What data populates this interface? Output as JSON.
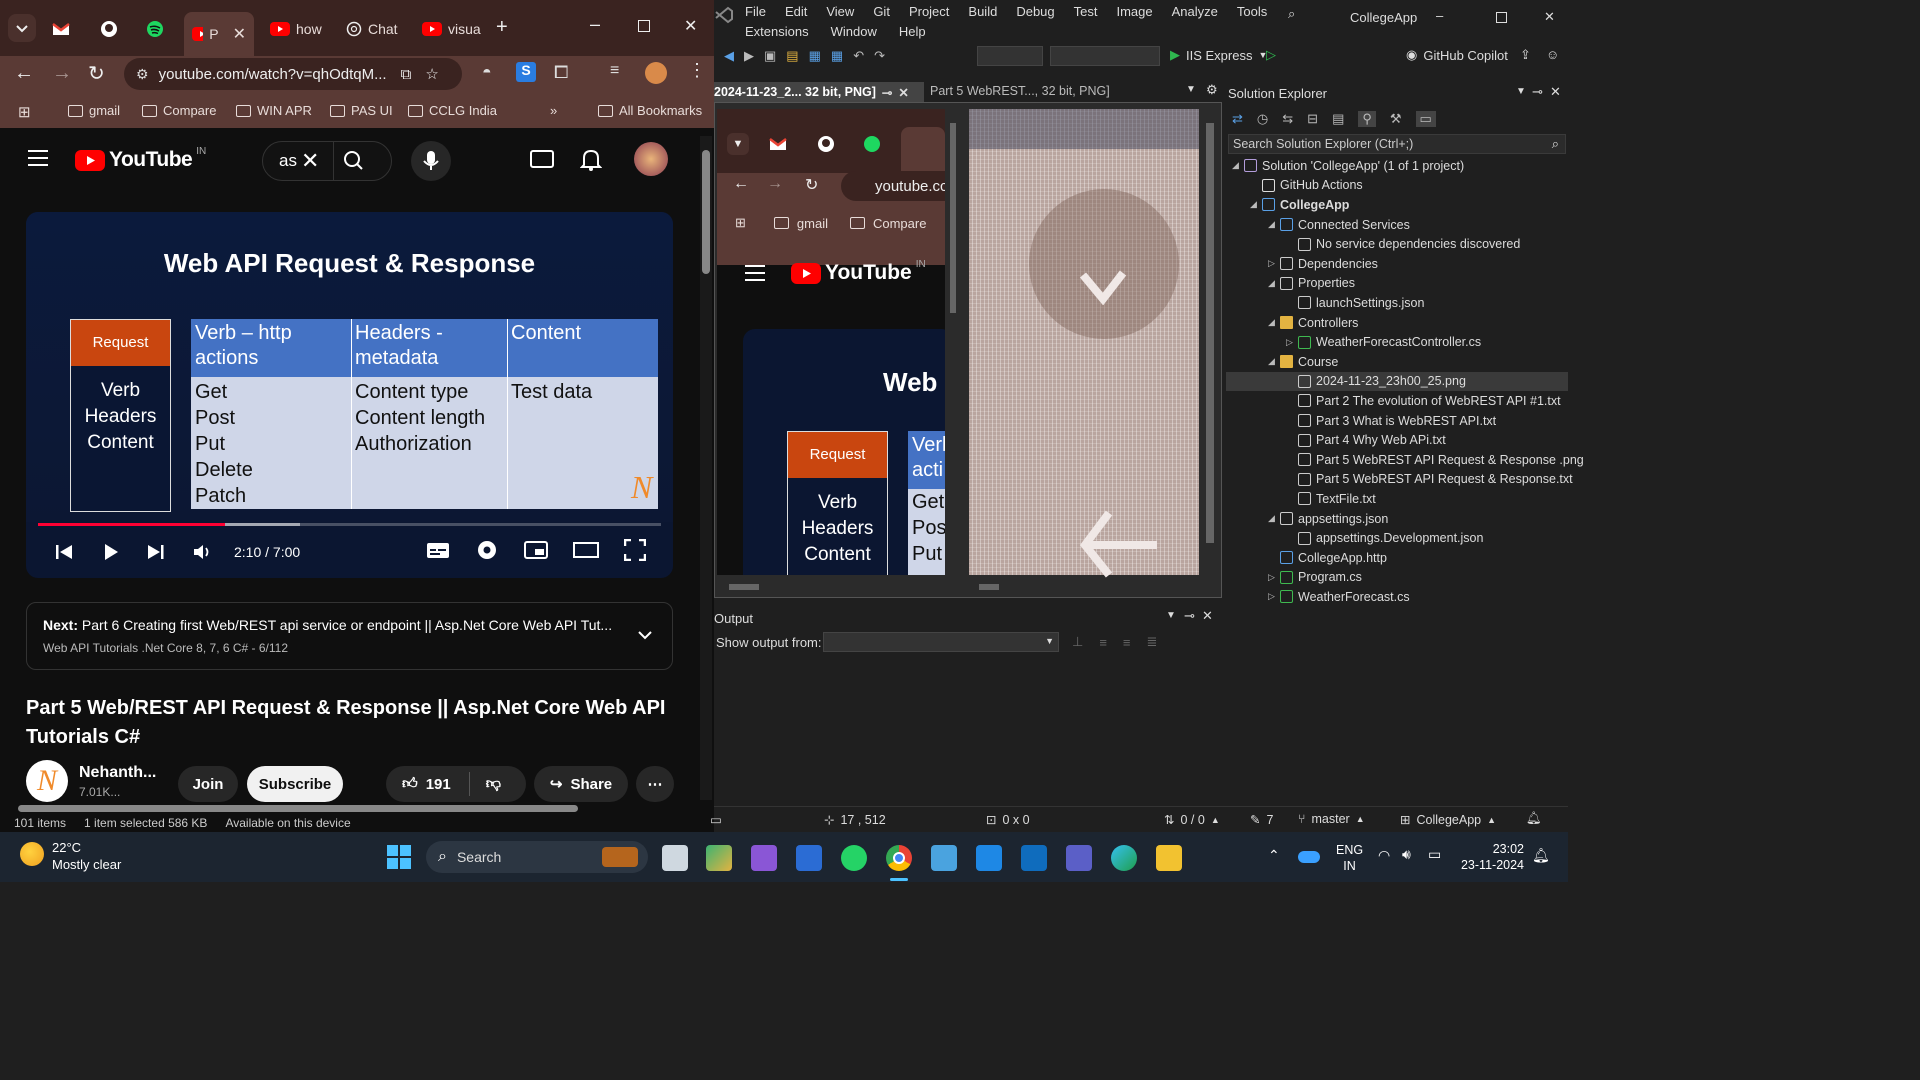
{
  "chrome": {
    "tabs": [
      {
        "label": "",
        "icon": "gmail-icon"
      },
      {
        "label": "",
        "icon": "github-icon"
      },
      {
        "label": "",
        "icon": "spotify-icon"
      },
      {
        "label": "P",
        "icon": "youtube-icon"
      },
      {
        "label": "how",
        "icon": "youtube-icon"
      },
      {
        "label": "Chat",
        "icon": "chatgpt-icon"
      },
      {
        "label": "visua",
        "icon": "youtube-icon"
      }
    ],
    "url": "youtube.com/watch?v=qhOdtqM...",
    "bookmarks": [
      "gmail",
      "Compare",
      "WIN APR",
      "PAS UI",
      "CCLG India"
    ],
    "all_bookmarks": "All Bookmarks",
    "accent": "#5a3a35"
  },
  "youtube": {
    "logo_text": "YouTube",
    "region": "IN",
    "search_text": "as",
    "slide": {
      "title": "Web API Request & Response",
      "request_header": "Request",
      "request_items": [
        "Verb",
        "Headers",
        "Content"
      ],
      "col1_header": "Verb – http actions",
      "col2_header": "Headers - metadata",
      "col3_header": "Content",
      "col1_items": [
        "Get",
        "Post",
        "Put",
        "Delete",
        "Patch"
      ],
      "col2_items": [
        "Content type",
        "Content length",
        "Authorization"
      ],
      "col3_items": [
        "Test data"
      ],
      "watermark": "N"
    },
    "player": {
      "time": "2:10 / 7:00",
      "progress": 0.3,
      "buffered": 0.42
    },
    "next": {
      "prefix": "Next:",
      "title": "Part 6 Creating first Web/REST api service or endpoint || Asp.Net Core Web API Tut...",
      "playlist": "Web API Tutorials .Net Core 8, 7, 6 C# - 6/112"
    },
    "video_title": "Part 5 Web/REST API Request & Response || Asp.Net Core Web API Tutorials C#",
    "channel": "Nehanth...",
    "subscribers": "7.01K...",
    "join": "Join",
    "subscribe": "Subscribe",
    "likes": "191",
    "share": "Share"
  },
  "explorer_status": {
    "items": "101 items",
    "selected": "1 item selected 586 KB",
    "availability": "Available on this device"
  },
  "vs": {
    "menu": [
      "File",
      "Edit",
      "View",
      "Git",
      "Project",
      "Build",
      "Debug",
      "Test",
      "Image",
      "Analyze",
      "Tools"
    ],
    "menu2": [
      "Extensions",
      "Window",
      "Help"
    ],
    "app_name": "CollegeApp",
    "run_label": "IIS Express",
    "copilot": "GitHub Copilot",
    "doc_tabs": [
      "2024-11-23_2... 32 bit, PNG]",
      "Part 5 WebREST..., 32 bit, PNG]"
    ],
    "preview": {
      "bookmarks": [
        "gmail",
        "Compare"
      ],
      "url": "youtube.cc",
      "logo_text": "YouTube",
      "region": "IN",
      "slide_title": "Web",
      "request_header": "Request",
      "request_items": [
        "Verb",
        "Headers",
        "Content"
      ],
      "col_header": "Verl acti",
      "col_items": [
        "Get",
        "Pos",
        "Put"
      ]
    },
    "output": {
      "title": "Output",
      "show_from": "Show output from:"
    },
    "solution_explorer": {
      "title": "Solution Explorer",
      "search_placeholder": "Search Solution Explorer (Ctrl+;)",
      "items": [
        {
          "label": "Solution 'CollegeApp' (1 of 1 project)",
          "level": 0,
          "icon": "solution-icon"
        },
        {
          "label": "GitHub Actions",
          "level": 1,
          "icon": "github-icon"
        },
        {
          "label": "CollegeApp",
          "level": 1,
          "icon": "project-icon",
          "bold": true
        },
        {
          "label": "Connected Services",
          "level": 2,
          "icon": "connected-services-icon"
        },
        {
          "label": "No service dependencies discovered",
          "level": 3,
          "icon": "file-icon"
        },
        {
          "label": "Dependencies",
          "level": 2,
          "icon": "dependencies-icon"
        },
        {
          "label": "Properties",
          "level": 2,
          "icon": "properties-icon"
        },
        {
          "label": "launchSettings.json",
          "level": 3,
          "icon": "json-icon"
        },
        {
          "label": "Controllers",
          "level": 2,
          "icon": "folder-icon"
        },
        {
          "label": "WeatherForecastController.cs",
          "level": 3,
          "icon": "csharp-icon"
        },
        {
          "label": "Course",
          "level": 2,
          "icon": "folder-icon"
        },
        {
          "label": "2024-11-23_23h00_25.png",
          "level": 3,
          "icon": "image-icon",
          "selected": true
        },
        {
          "label": "Part 2 The evolution of WebREST API #1.txt",
          "level": 3,
          "icon": "text-file-icon"
        },
        {
          "label": "Part 3 What is WebREST API.txt",
          "level": 3,
          "icon": "text-file-icon"
        },
        {
          "label": "Part 4 Why Web APi.txt",
          "level": 3,
          "icon": "text-file-icon"
        },
        {
          "label": "Part 5 WebREST API Request & Response .png",
          "level": 3,
          "icon": "image-icon"
        },
        {
          "label": "Part 5 WebREST API Request & Response.txt",
          "level": 3,
          "icon": "text-file-icon"
        },
        {
          "label": "TextFile.txt",
          "level": 3,
          "icon": "text-file-icon"
        },
        {
          "label": "appsettings.json",
          "level": 2,
          "icon": "json-icon"
        },
        {
          "label": "appsettings.Development.json",
          "level": 3,
          "icon": "json-icon"
        },
        {
          "label": "CollegeApp.http",
          "level": 2,
          "icon": "http-icon"
        },
        {
          "label": "Program.cs",
          "level": 2,
          "icon": "csharp-icon"
        },
        {
          "label": "WeatherForecast.cs",
          "level": 2,
          "icon": "csharp-icon"
        }
      ]
    },
    "status": {
      "position": "17 , 512",
      "selection": "0 x 0",
      "changes": "0 / 0",
      "edits": "7",
      "branch": "master",
      "repo": "CollegeApp"
    }
  },
  "taskbar": {
    "weather_temp": "22°C",
    "weather_desc": "Mostly clear",
    "search": "Search",
    "lang1": "ENG",
    "lang2": "IN",
    "time": "23:02",
    "date": "23-11-2024"
  }
}
